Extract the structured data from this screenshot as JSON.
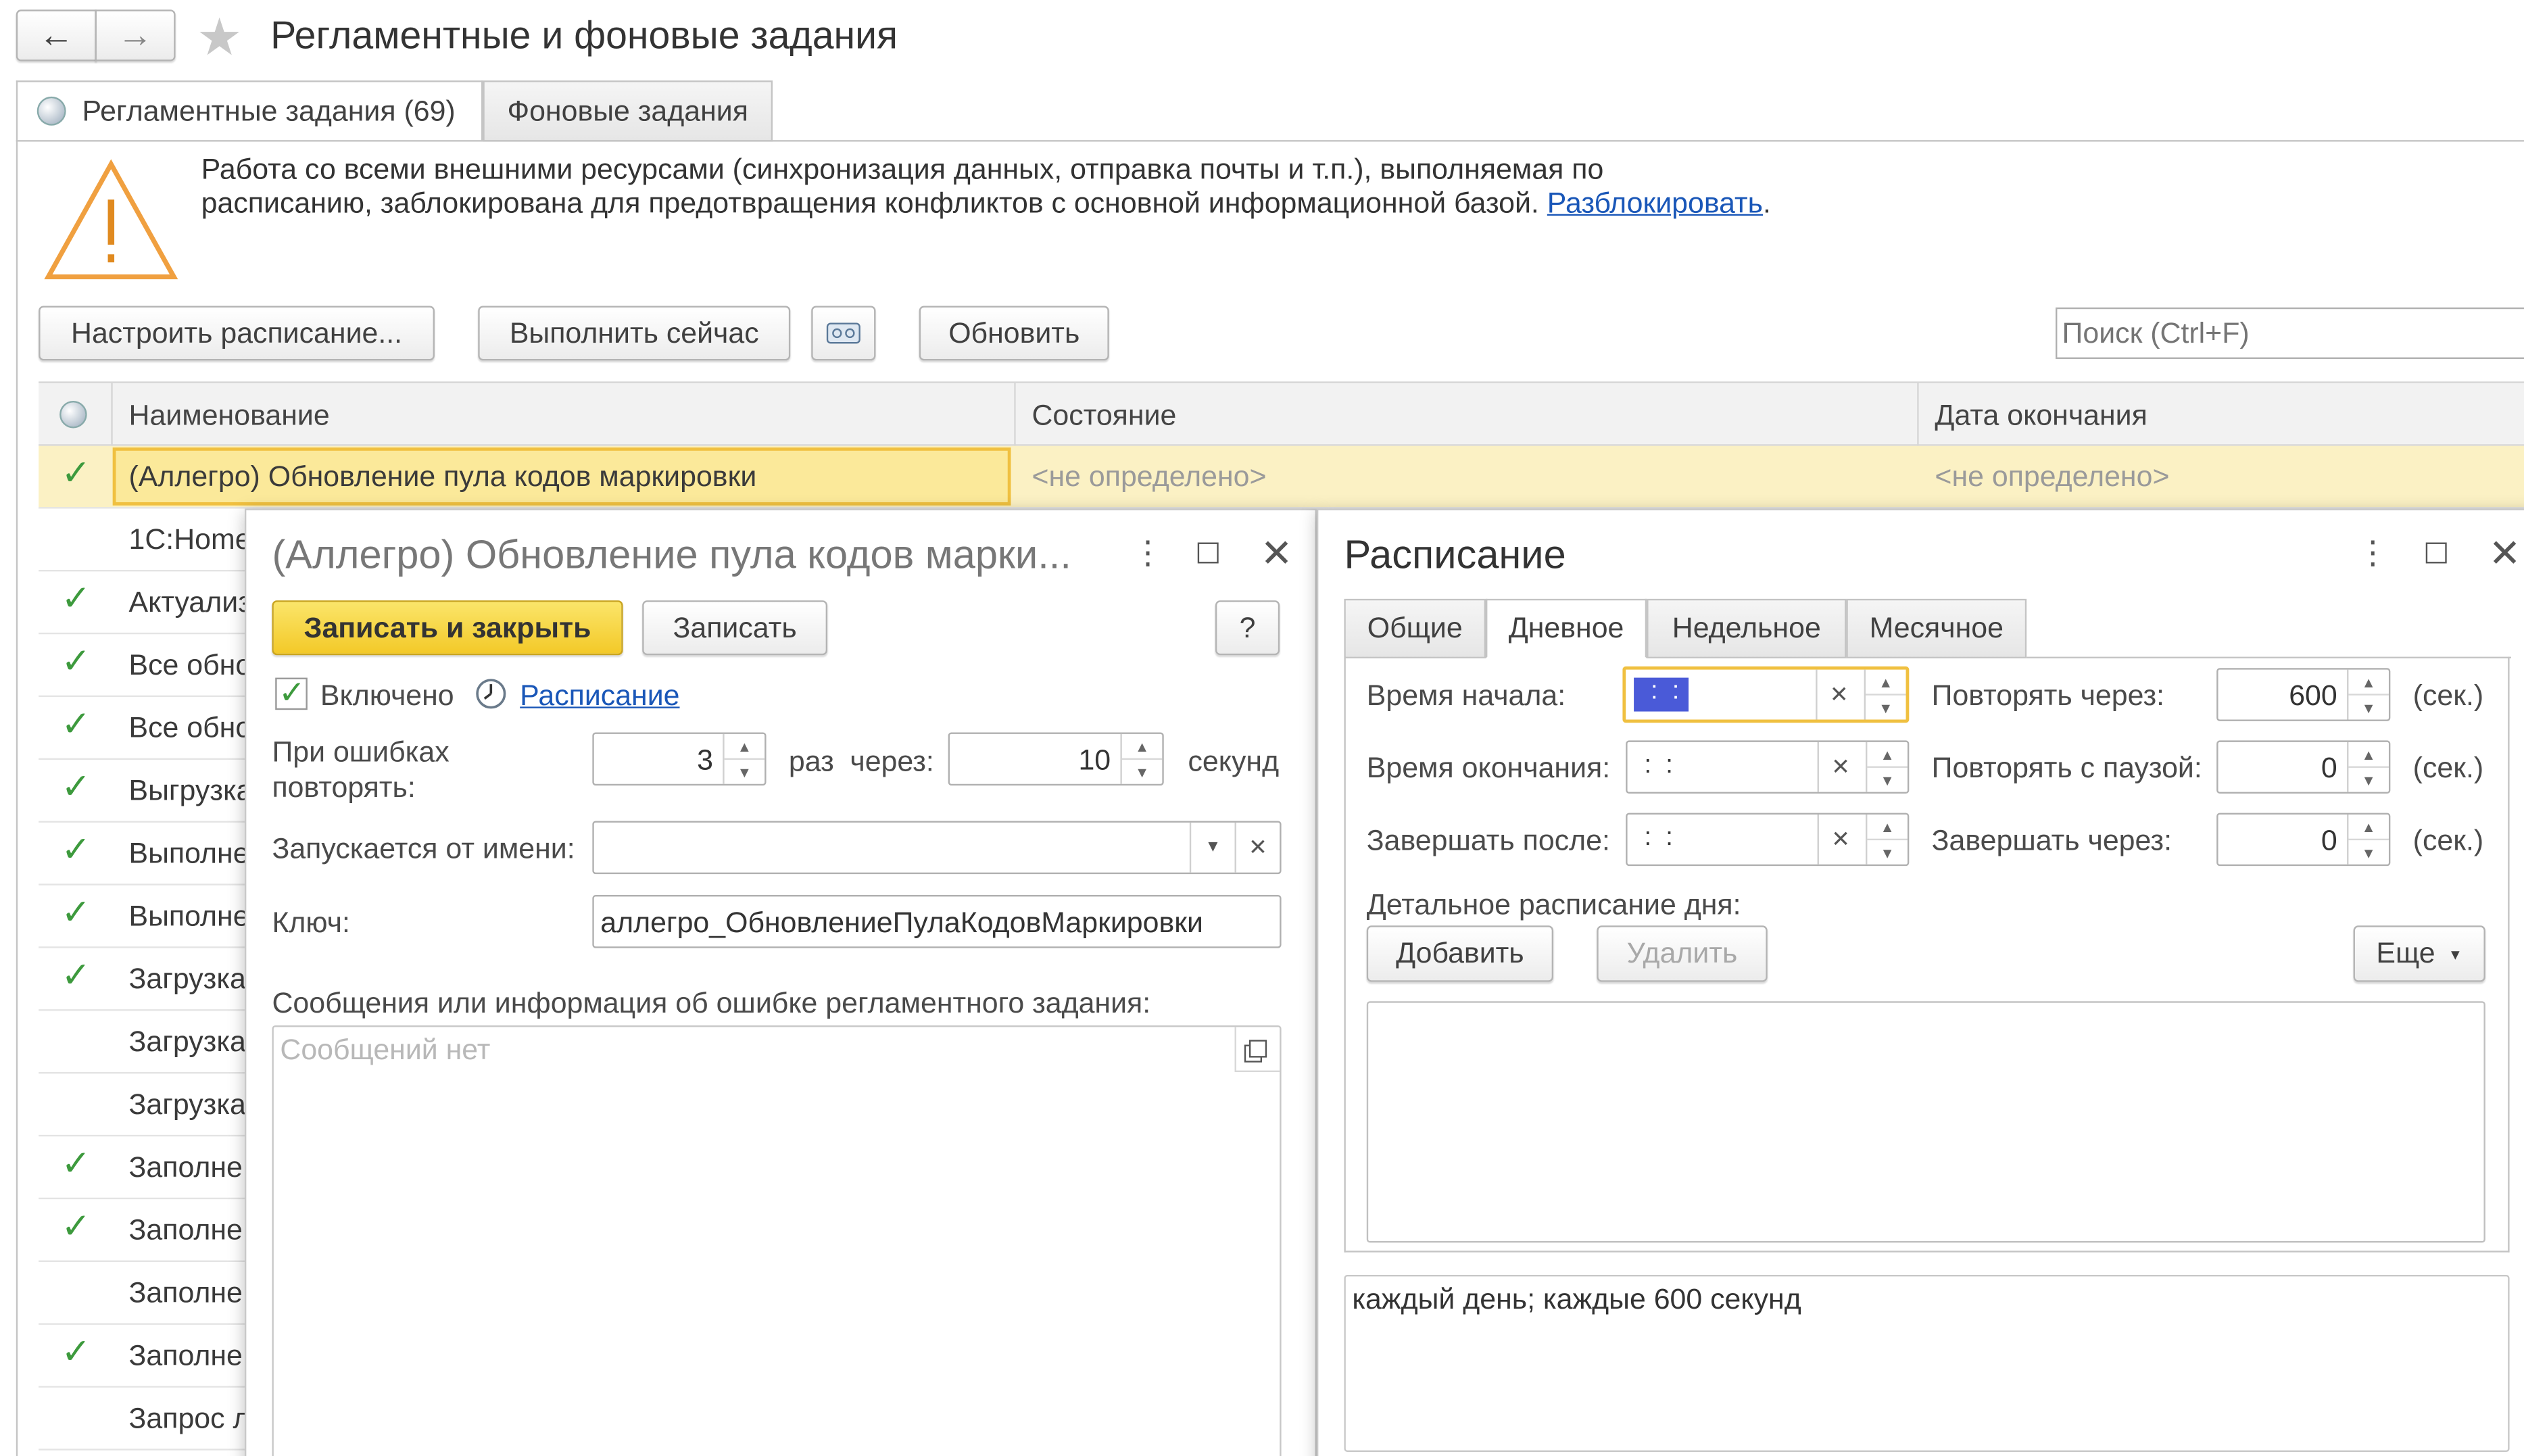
{
  "window": {
    "title": "Регламентные и фоновые задания",
    "back": "←",
    "forward": "→",
    "star": "★"
  },
  "tabs": [
    {
      "label": "Регламентные задания (69)"
    },
    {
      "label": "Фоновые задания"
    }
  ],
  "warning": {
    "line1": "Работа со всеми внешними ресурсами (синхронизация данных, отправка почты и т.п.), выполняемая по",
    "line2": "расписанию, заблокирована для предотвращения конфликтов с основной информационной базой.",
    "link": "Разблокировать",
    "after": "."
  },
  "toolbar": {
    "schedule": "Настроить расписание...",
    "run_now": "Выполнить сейчас",
    "refresh": "Обновить",
    "search_placeholder": "Поиск (Ctrl+F)"
  },
  "table": {
    "columns": [
      "Наименование",
      "Состояние",
      "Дата окончания"
    ],
    "rows": [
      {
        "checked": true,
        "name": "(Аллегро) Обновление пула кодов маркировки",
        "state": "<не определено>",
        "end": "<не определено>"
      },
      {
        "checked": false,
        "name": "1С:Home"
      },
      {
        "checked": true,
        "name": "Актуализ"
      },
      {
        "checked": true,
        "name": "Все обно"
      },
      {
        "checked": true,
        "name": "Все обно"
      },
      {
        "checked": true,
        "name": "Выгрузка"
      },
      {
        "checked": true,
        "name": "Выполне"
      },
      {
        "checked": true,
        "name": "Выполне"
      },
      {
        "checked": true,
        "name": "Загрузка"
      },
      {
        "checked": false,
        "name": "Загрузка"
      },
      {
        "checked": false,
        "name": "Загрузка"
      },
      {
        "checked": true,
        "name": "Заполне"
      },
      {
        "checked": true,
        "name": "Заполне"
      },
      {
        "checked": false,
        "name": "Заполне"
      },
      {
        "checked": true,
        "name": "Заполне"
      },
      {
        "checked": false,
        "name": "Запрос л"
      }
    ]
  },
  "job_dialog": {
    "title": "(Аллегро) Обновление пула кодов марки...",
    "save_close": "Записать и закрыть",
    "save": "Записать",
    "help": "?",
    "enabled_label": "Включено",
    "schedule_link": "Расписание",
    "retry_label_1": "При ошибках",
    "retry_label_2": "повторять:",
    "retry_count": "3",
    "times_label": "раз",
    "via_label": "через:",
    "retry_interval": "10",
    "seconds_label": "секунд",
    "run_as_label": "Запускается от имени:",
    "run_as_value": "",
    "key_label": "Ключ:",
    "key_value": "аллегро_ОбновлениеПулаКодовМаркировки",
    "messages_label": "Сообщения или информация об ошибке регламентного задания:",
    "messages_placeholder": "Сообщений нет"
  },
  "schedule_dialog": {
    "title": "Расписание",
    "tabs": [
      "Общие",
      "Дневное",
      "Недельное",
      "Месячное"
    ],
    "start_time_label": "Время начала:",
    "start_time_value": " :  :",
    "end_time_label": "Время окончания:",
    "end_time_value": " :  :",
    "finish_after_label": "Завершать после:",
    "finish_after_value": " :  :",
    "repeat_every_label": "Повторять через:",
    "repeat_every_value": "600",
    "repeat_pause_label": "Повторять с паузой:",
    "repeat_pause_value": "0",
    "finish_in_label": "Завершать через:",
    "finish_in_value": "0",
    "sec_unit": "(сек.)",
    "detail_label": "Детальное расписание дня:",
    "add": "Добавить",
    "delete": "Удалить",
    "more": "Еще",
    "summary": "каждый день; каждые 600 секунд"
  }
}
